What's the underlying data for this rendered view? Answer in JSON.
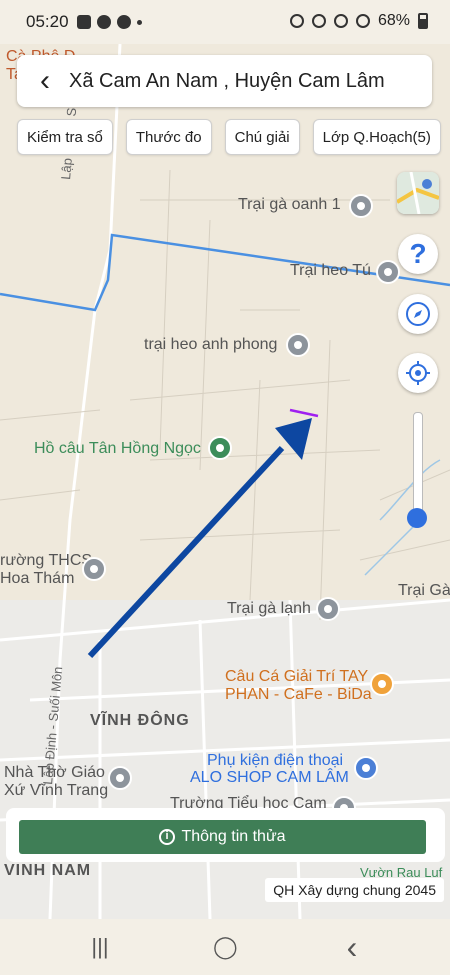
{
  "status_bar": {
    "time": "05:20",
    "battery": "68%"
  },
  "header": {
    "title": "Xã Cam An Nam , Huyện Cam Lâm"
  },
  "chips": [
    "Kiểm tra sổ",
    "Thước đo",
    "Chú giải",
    "Lớp Q.Hoạch(5)"
  ],
  "map_labels": {
    "cap1": "Cà Phê Đ",
    "cap2": "Ta",
    "road1": "Lập Định - Suối Mơ",
    "poi1": "Trại gà oanh 1",
    "poi2": "Trại heo Tú",
    "poi3": "trại heo anh phong",
    "poi4": "Hồ câu Tân Hồng Ngọc",
    "poi5": "rường THCS",
    "poi6": "Hoa Thám",
    "poi7": "Trại gà lạnh",
    "poi8": "Trại Gà",
    "poi9": "Câu Cá Giải Trí TAY",
    "poi9b": "PHAN - CaFe - BiDa",
    "road2": "Lập Định - Suối Môn",
    "area1": "VĨNH ĐÔNG",
    "poi10": "Phụ kiện điện thoại",
    "poi10b": "ALO SHOP CAM LÂM",
    "poi11": "Nhà Thờ Giáo",
    "poi11b": "Xứ Vĩnh Trang",
    "poi12": "Trường Tiểu học Cam",
    "area2": "VINH NAM",
    "poi13": "Vườn Rau Luf"
  },
  "controls": {
    "help": "?"
  },
  "bottom": {
    "info_button": "Thông tin thửa",
    "plan_label": "QH Xây dựng chung 2045"
  },
  "nav": {
    "recent": "|||",
    "home": "◯",
    "back": "‹"
  },
  "colors": {
    "boundary": "#4a90e2",
    "arrow": "#0d47a1",
    "parcel": "#a020f0",
    "accent_green": "#3f7e56"
  }
}
